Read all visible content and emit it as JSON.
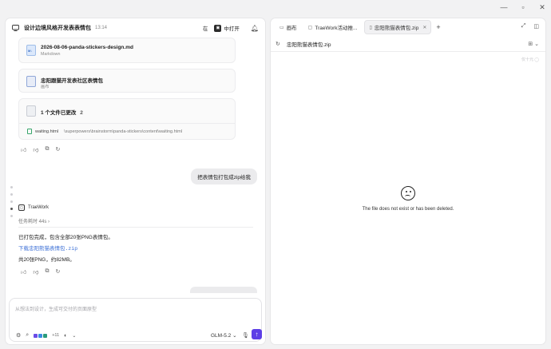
{
  "window": {
    "minimize": "—",
    "maximize": "▫",
    "close": "✕"
  },
  "left": {
    "header": {
      "title": "设计边境风格开发表表情包",
      "time": "13:14",
      "left_label": "在",
      "open_label": "中打开"
    },
    "cards": [
      {
        "title": "2026-08-06-panda-stickers-design.md",
        "subtitle": "Markdown"
      },
      {
        "title": "忠阳跟猫开发表社区表情包",
        "subtitle": "画布"
      }
    ],
    "changes": {
      "title": "1 个文件已更改",
      "count_suffix": "2",
      "file_name": "waiting.html",
      "file_path": "\\superpowers\\brainstorm\\panda-stickers\\content\\waiting.html"
    },
    "user_message": "把表情包打包成zip给我",
    "agent_name": "TraeWork",
    "task_time": "任务耗时 44s",
    "reply": {
      "line1": "已打包完成，包含全部20张PNG表情包。",
      "link": "下载忠阳熊猫表情包.zip",
      "line3": "共20张PNG，约82MB。"
    },
    "input_placeholder": "从想法到设计，生成可交付的页面原型",
    "tools": {
      "plus_count": "+11"
    },
    "model": "GLM-5.2"
  },
  "right": {
    "tabs": [
      {
        "label": "画布"
      },
      {
        "label": "TraeWork活动推..."
      },
      {
        "label": "忠阳熊猫表情包.zip",
        "active": true
      }
    ],
    "address_file": "忠阳熊猫表情包.zip",
    "faint_text": "仅十元 ◯",
    "error_text": "The file does not exist or has been deleted."
  }
}
